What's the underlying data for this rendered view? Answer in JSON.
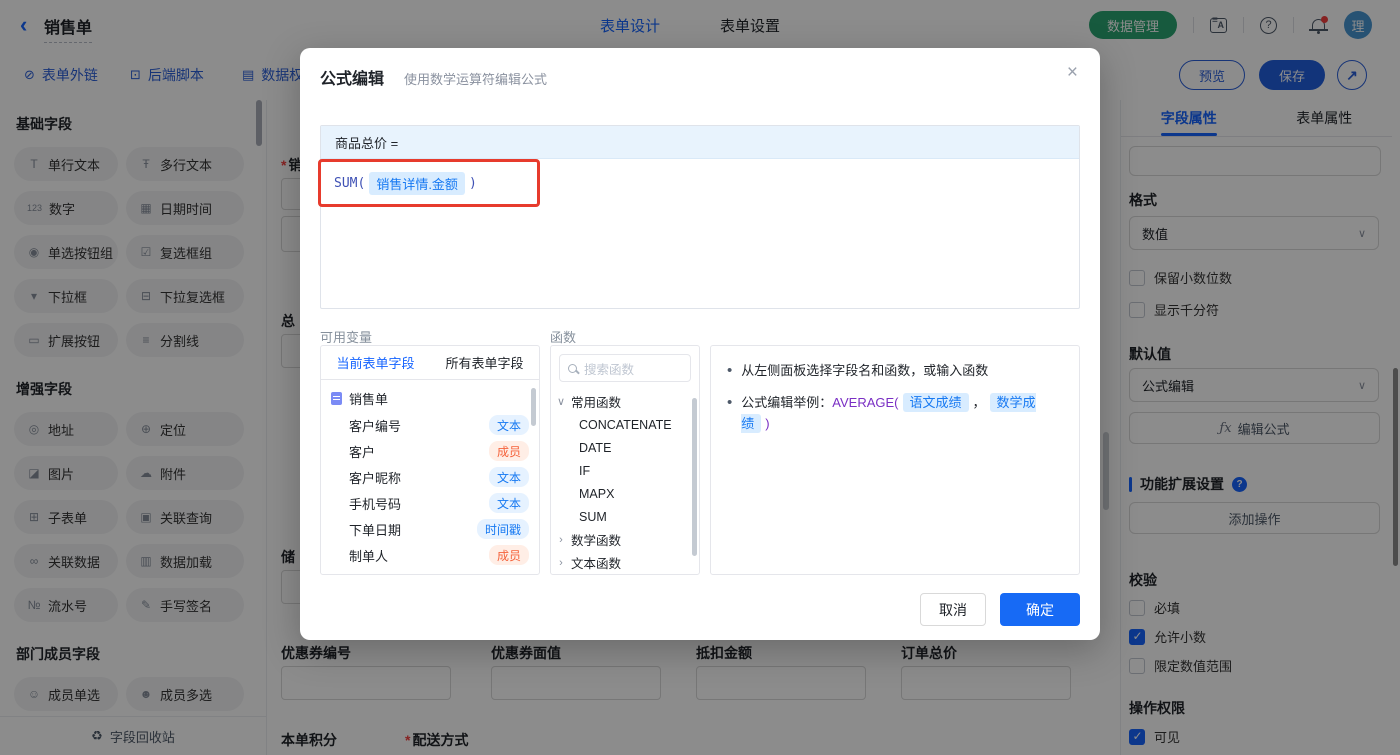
{
  "colors": {
    "accent": "#1664ff",
    "green": "#2ba471",
    "annotation_red": "#e73b2d",
    "token_blue": "#1779f2",
    "member_orange": "#f5633c",
    "confirm_blue": "#176af5"
  },
  "topbar": {
    "back_glyph": "‹",
    "title": "销售单",
    "tabs": [
      {
        "label": "表单设计"
      },
      {
        "label": "表单设置"
      }
    ],
    "data_manage": "数据管理",
    "help_glyph": "?",
    "avatar": "理"
  },
  "toolbar": {
    "links": [
      {
        "label": "表单外链",
        "glyph": "⊘"
      },
      {
        "label": "后端脚本",
        "glyph": "⊡"
      },
      {
        "label": "数据权",
        "glyph": "▤"
      }
    ],
    "preview": "预览",
    "save": "保存",
    "share_glyph": "↗"
  },
  "sidebar": {
    "sections": [
      {
        "title": "基础字段",
        "items": [
          {
            "label": "单行文本",
            "glyph": "T"
          },
          {
            "label": "多行文本",
            "glyph": "Ŧ"
          },
          {
            "label": "数字",
            "glyph": "123"
          },
          {
            "label": "日期时间",
            "glyph": "▦"
          },
          {
            "label": "单选按钮组",
            "glyph": "◉"
          },
          {
            "label": "复选框组",
            "glyph": "☑"
          },
          {
            "label": "下拉框",
            "glyph": "▾"
          },
          {
            "label": "下拉复选框",
            "glyph": "⊟"
          },
          {
            "label": "扩展按钮",
            "glyph": "▭"
          },
          {
            "label": "分割线",
            "glyph": "≡"
          }
        ]
      },
      {
        "title": "增强字段",
        "items": [
          {
            "label": "地址",
            "glyph": "◎"
          },
          {
            "label": "定位",
            "glyph": "⊕"
          },
          {
            "label": "图片",
            "glyph": "◪"
          },
          {
            "label": "附件",
            "glyph": "☁"
          },
          {
            "label": "子表单",
            "glyph": "⊞"
          },
          {
            "label": "关联查询",
            "glyph": "▣"
          },
          {
            "label": "关联数据",
            "glyph": "∞"
          },
          {
            "label": "数据加载",
            "glyph": "▥"
          },
          {
            "label": "流水号",
            "glyph": "№"
          },
          {
            "label": "手写签名",
            "glyph": "✎"
          }
        ]
      },
      {
        "title": "部门成员字段",
        "items": [
          {
            "label": "成员单选",
            "glyph": "☺"
          },
          {
            "label": "成员多选",
            "glyph": "☻"
          }
        ]
      }
    ],
    "recycle": {
      "label": "字段回收站",
      "glyph": "♻"
    }
  },
  "canvas": {
    "partials": [
      {
        "label": "销",
        "required": "*"
      },
      {
        "label": "总"
      },
      {
        "label": "储"
      }
    ],
    "coupon_row": [
      "优惠券编号",
      "优惠券面值",
      "抵扣金额",
      "订单总价"
    ],
    "row2": {
      "points": "本单积分",
      "delivery": "配送方式",
      "delivery_required": "*"
    }
  },
  "modal": {
    "title": "公式编辑",
    "subtitle": "使用数学运算符编辑公式",
    "close_glyph": "×",
    "editor": {
      "target": "商品总价 =",
      "func": "SUM(",
      "token": "销售详情.金额",
      "close_paren": ")"
    },
    "variables": {
      "label": "可用变量",
      "tabs": [
        "当前表单字段",
        "所有表单字段"
      ],
      "root": "销售单",
      "fields": [
        {
          "name": "客户编号",
          "type": "文本"
        },
        {
          "name": "客户",
          "type": "成员"
        },
        {
          "name": "客户昵称",
          "type": "文本"
        },
        {
          "name": "手机号码",
          "type": "文本"
        },
        {
          "name": "下单日期",
          "type": "时间戳"
        },
        {
          "name": "制单人",
          "type": "成员"
        }
      ]
    },
    "functions": {
      "label": "函数",
      "search_placeholder": "搜索函数",
      "group_common": "常用函数",
      "common_items": [
        "CONCATENATE",
        "DATE",
        "IF",
        "MAPX",
        "SUM"
      ],
      "group_math": "数学函数",
      "group_text": "文本函数",
      "chevron_down": "∨",
      "chevron_right": "›"
    },
    "tips": {
      "line1": "从左侧面板选择字段名和函数，或输入函数",
      "example": {
        "prefix": "公式编辑举例：",
        "func": "AVERAGE(",
        "arg1": "语文成绩",
        "comma": "，",
        "arg2": "数学成绩",
        "close": ")"
      }
    },
    "footer": {
      "cancel": "取消",
      "ok": "确定"
    }
  },
  "right_panel": {
    "tabs": [
      {
        "label": "字段属性"
      },
      {
        "label": "表单属性"
      }
    ],
    "format": {
      "label": "格式",
      "value": "数值",
      "chevron": "∨"
    },
    "format_options": [
      {
        "label": "保留小数位数"
      },
      {
        "label": "显示千分符"
      }
    ],
    "default": {
      "label": "默认值",
      "value": "公式编辑",
      "chevron": "∨",
      "fx": "ƒx",
      "edit_button": "编辑公式"
    },
    "extension": {
      "label": "功能扩展设置",
      "help_glyph": "?",
      "add_button": "添加操作"
    },
    "validation": {
      "label": "校验",
      "items": [
        {
          "label": "必填"
        },
        {
          "label": "允许小数"
        },
        {
          "label": "限定数值范围"
        }
      ]
    },
    "permission": {
      "label": "操作权限",
      "items": [
        {
          "label": "可见"
        }
      ]
    }
  }
}
